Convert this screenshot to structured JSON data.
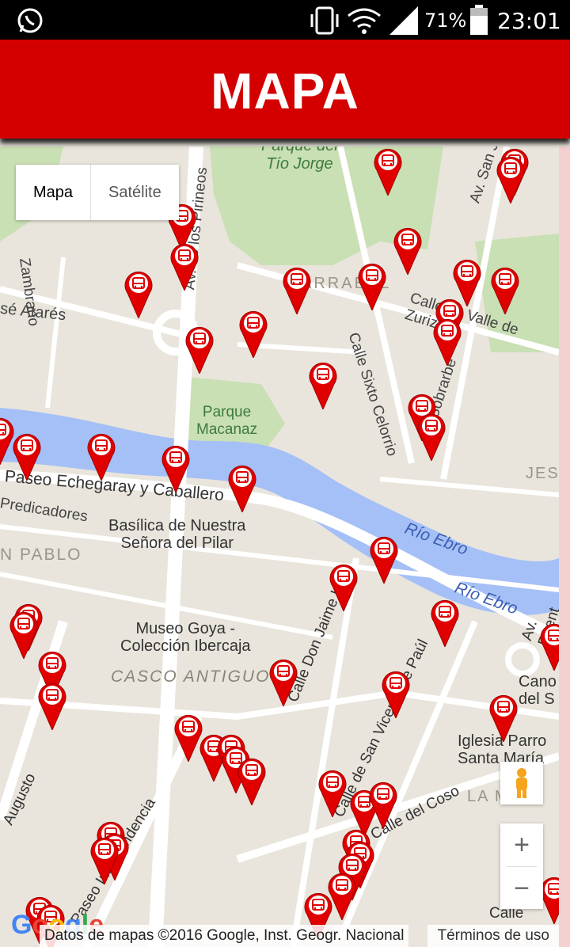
{
  "status_bar": {
    "battery": "71%",
    "time": "23:01",
    "icons": [
      "whatsapp-icon",
      "vibrate-icon",
      "wifi-icon",
      "signal-icon",
      "battery-icon"
    ]
  },
  "app_bar": {
    "title": "MAPA",
    "color": "#d40000"
  },
  "map_type": {
    "map_label": "Mapa",
    "satellite_label": "Satélite"
  },
  "map_labels": {
    "parque_tio_jorge": "Parque del\nTío Jorge",
    "arrabal": "ARRABAL",
    "calle_valle_zuriza": "Calle de Valle de Zuriza",
    "av_san_juan": "Av. San Ju",
    "jose_atares": "sé Atarés",
    "zambrano": "Zambrano",
    "av_pirineos": "Av. de los Pirineos",
    "calle_sixto_celorrio": "Calle Sixto Celorrio",
    "calle_sobrarbe": "C. Sobrarbe",
    "parque_macanaz": "Parque\nMacanaz",
    "paseo_echegaray": "Paseo Echegaray y Caballero",
    "predicadores": "Predicadores",
    "jes": "JES",
    "rio_ebro_1": "Río Ebro",
    "rio_ebro_2": "Río Ebro",
    "basilica": "Basílica de Nuestra\nSeñora del Pilar",
    "san_pablo": "N PABLO",
    "museo_goya": "Museo Goya -\nColección Ibercaja",
    "casco_antiguo": "CASCO ANTIGUO",
    "calle_don_jaime": "Calle Don Jaime I",
    "calle_san_vicente": "Calle de San Vicente de Paúl",
    "av_puente": "Av. Puent",
    "cano": "Cano\ndel S",
    "iglesia": "Iglesia Parro\nSanta María",
    "la_m": "LA M",
    "augusto": "Augusto",
    "paseo_independencia": "Paseo Independencia",
    "calle_coso": "Calle del Coso",
    "calle": "Calle"
  },
  "attribution": "Datos de mapas ©2016 Google, Inst. Geogr. Nacional",
  "terms": "Términos de uso",
  "google_logo": "Google",
  "zoom": {
    "in": "+",
    "out": "−"
  },
  "marker_color": "#e00000"
}
